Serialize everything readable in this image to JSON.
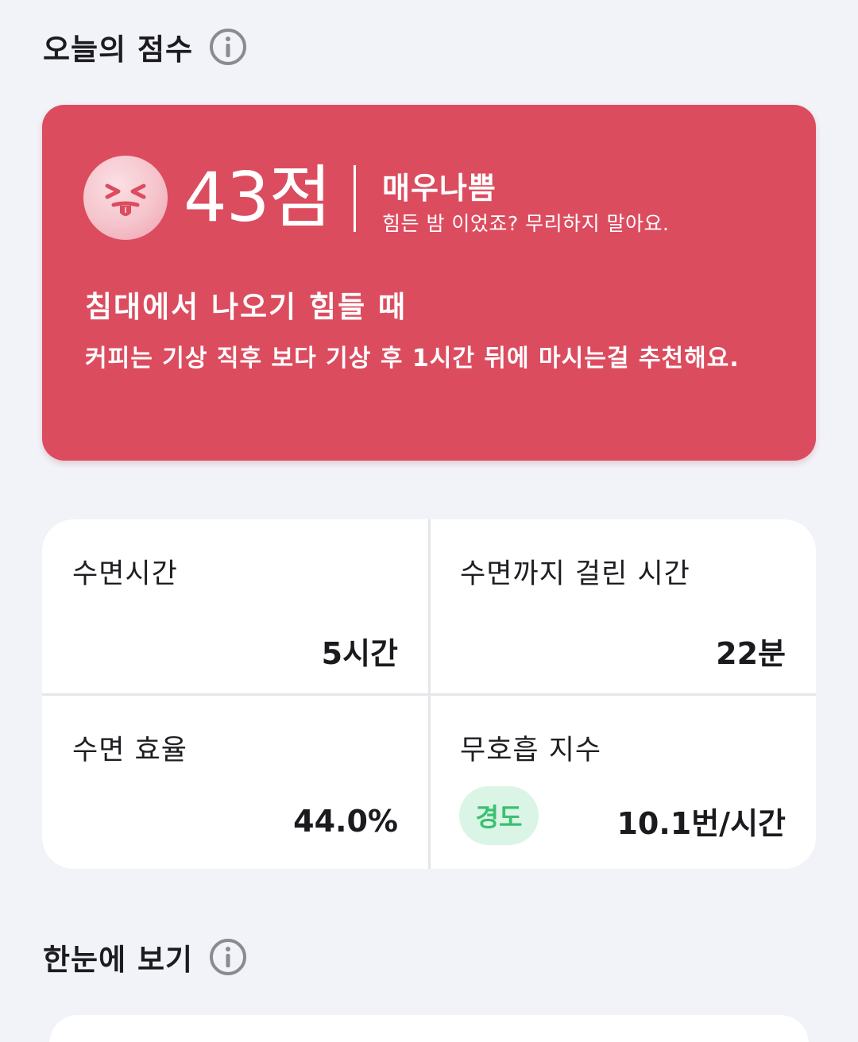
{
  "today_section": {
    "title": "오늘의 점수",
    "info_icon": "info-circle-icon"
  },
  "score_card": {
    "background_color": "#dc4c5f",
    "face_icon": "dizzy-face-tongue-out-icon",
    "score": "43점",
    "grade": "매우나쁨",
    "grade_message": "힘든 밤 이었죠? 무리하지 말아요.",
    "tip_title": "침대에서 나오기 힘들 때",
    "tip_body": "커피는 기상 직후 보다 기상 후 1시간 뒤에 마시는걸 추천해요."
  },
  "stats": {
    "sleep_time": {
      "label": "수면시간",
      "value": "5시간"
    },
    "sleep_latency": {
      "label": "수면까지 걸린 시간",
      "value": "22분"
    },
    "sleep_efficiency": {
      "label": "수면 효율",
      "value": "44.0%"
    },
    "apnea_index": {
      "label": "무호흡 지수",
      "badge": "경도",
      "badge_color": "#3cbf72",
      "value": "10.1번/시간"
    }
  },
  "overview_section": {
    "title": "한눈에 보기",
    "info_icon": "info-circle-icon"
  }
}
